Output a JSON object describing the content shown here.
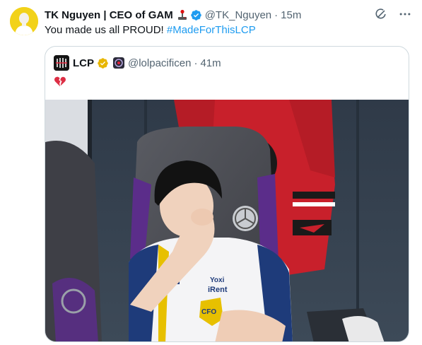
{
  "tweet": {
    "author_name": "TK Nguyen | CEO of GAM",
    "author_emoji": "joystick-emoji",
    "author_handle": "@TK_Nguyen",
    "separator": "·",
    "time": "15m",
    "text_before": "You made us all PROUD! ",
    "hashtag": "#MadeForThisLCP",
    "avatar_bg": "#f2d21a",
    "hashtag_color": "#1d9bf0"
  },
  "quoted": {
    "author_name": "LCP",
    "author_handle": "@lolpacificen",
    "separator": "·",
    "time": "41m",
    "text": "broken-heart-emoji",
    "badge_color": "#e8b600",
    "image_alt": "Player in a gaming chair wiping his eye, wearing a CFO jersey, red team jersey hanging on the wall"
  },
  "photo": {
    "chair_logo": "mercedes-star",
    "jersey_badge": "CFO",
    "sponsor": "Yoxi iRent"
  },
  "icons": {
    "grok": "grok-icon",
    "more": "more-options-icon",
    "verified": "verified-badge-icon"
  }
}
